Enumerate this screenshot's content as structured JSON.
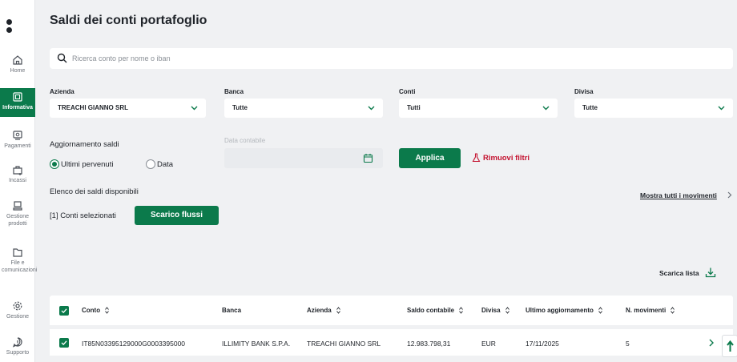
{
  "sidebar": {
    "items": [
      {
        "label": "Home",
        "icon": "home-icon"
      },
      {
        "label": "Informativa",
        "icon": "report-icon",
        "active": true
      },
      {
        "label": "Pagamenti",
        "icon": "payments-icon"
      },
      {
        "label": "Incassi",
        "icon": "collections-icon"
      },
      {
        "label": "Gestione prodotti",
        "icon": "products-icon"
      },
      {
        "label": "File e comunicazioni",
        "icon": "folder-icon"
      },
      {
        "label": "Gestione",
        "icon": "gear-icon"
      },
      {
        "label": "Supporto",
        "icon": "support-icon"
      }
    ]
  },
  "page": {
    "title": "Saldi dei conti portafoglio"
  },
  "search": {
    "placeholder": "Ricerca conto per nome o iban",
    "value": ""
  },
  "filters": {
    "azienda": {
      "label": "Azienda",
      "value": "TREACHI GIANNO SRL"
    },
    "banca": {
      "label": "Banca",
      "value": "Tutte"
    },
    "conti": {
      "label": "Conti",
      "value": "Tutti"
    },
    "divisa": {
      "label": "Divisa",
      "value": "Tutte"
    }
  },
  "aggiornamento": {
    "label": "Aggiornamento saldi",
    "options": [
      "Ultimi pervenuti",
      "Data"
    ],
    "selected": "Ultimi pervenuti"
  },
  "data_contabile": {
    "label": "Data contabile",
    "value": ""
  },
  "actions": {
    "apply": "Applica",
    "remove_filters": "Rimuovi filtri",
    "show_all": "Mostra tutti i movimenti",
    "download_flows": "Scarico flussi",
    "download_list": "Scarica lista"
  },
  "list": {
    "heading": "Elenco dei saldi disponibili",
    "selected_count": "[1] Conti selezionati"
  },
  "table": {
    "columns": [
      "Conto",
      "Banca",
      "Azienda",
      "Saldo contabile",
      "Divisa",
      "Ultimo aggiornamento",
      "N. movimenti"
    ],
    "rows": [
      {
        "conto": "IT85N03395129000G0003395000",
        "banca": "ILLIMITY BANK S.P.A.",
        "azienda": "TREACHI GIANNO SRL",
        "saldo": "12.983.798,31",
        "divisa": "EUR",
        "aggiornamento": "17/11/2025",
        "movimenti": "5"
      }
    ]
  },
  "colors": {
    "brand_green": "#0b7a4b",
    "danger_red": "#c4122f",
    "background": "#f0f1f3"
  }
}
